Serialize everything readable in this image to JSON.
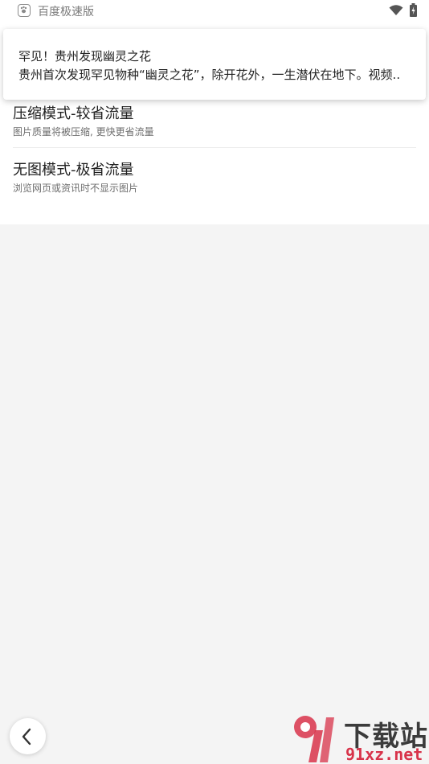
{
  "status_bar": {
    "app_name": "百度极速版",
    "app_icon": "baidu-paw-icon",
    "wifi_icon": "wifi-icon",
    "battery_icon": "battery-charging-icon"
  },
  "notification": {
    "title": "罕见！贵州发现幽灵之花",
    "body": "贵州首次发现罕见物种“幽灵之花”，除开花外，一生潜伏在地下。视频.."
  },
  "settings": {
    "items": [
      {
        "title": "",
        "subtitle": ""
      },
      {
        "title": "压缩模式-较省流量",
        "subtitle": "图片质量将被压缩, 更快更省流量"
      },
      {
        "title": "无图模式-极省流量",
        "subtitle": "浏览网页或资讯时不显示图片"
      }
    ]
  },
  "nav": {
    "back_icon": "chevron-left-icon"
  },
  "watermark": {
    "title": "下载站",
    "domain": "91xz.net",
    "logo_icon": "91-logo-icon",
    "color": "#d8334a"
  }
}
